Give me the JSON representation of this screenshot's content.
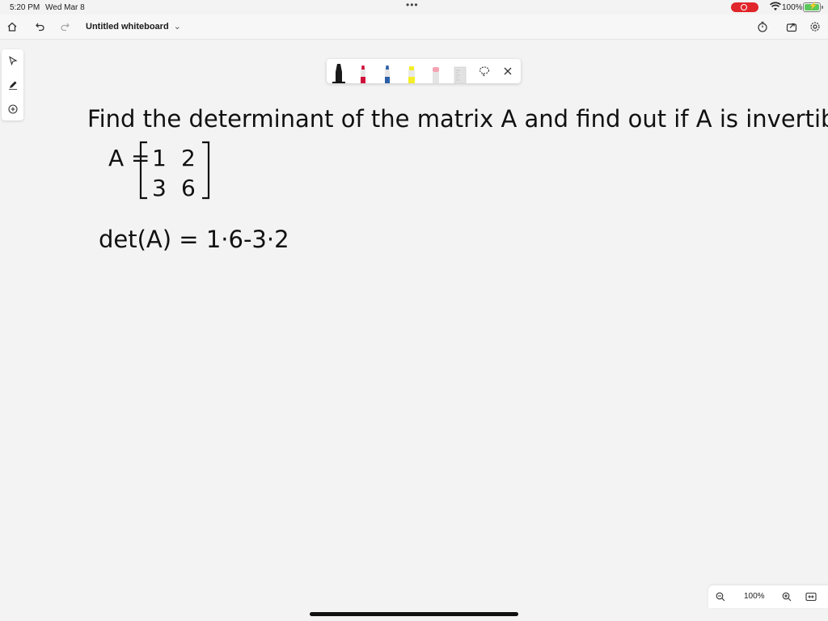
{
  "status": {
    "time": "5:20 PM",
    "date": "Wed Mar 8",
    "battery": "100%"
  },
  "toolbar": {
    "title": "Untitled whiteboard"
  },
  "whiteboard": {
    "question": "Find the determinant of the matrix A and find out if A is invertible.",
    "matrix_label": "A =",
    "matrix": [
      [
        "1",
        "2"
      ],
      [
        "3",
        "6"
      ]
    ],
    "det_expression": "det(A) = 1·6-3·2"
  },
  "pens": [
    {
      "name": "black-pen",
      "color": "#1a1a1a"
    },
    {
      "name": "red-pen",
      "color": "#d0103a"
    },
    {
      "name": "blue-pen",
      "color": "#2b5fa8"
    },
    {
      "name": "yellow-highlighter",
      "color": "#f4ee2a"
    },
    {
      "name": "pink-eraser",
      "color": "#f4a3b3"
    },
    {
      "name": "ruler",
      "color": "#d8d8d8"
    }
  ],
  "zoom": {
    "level": "100%"
  }
}
